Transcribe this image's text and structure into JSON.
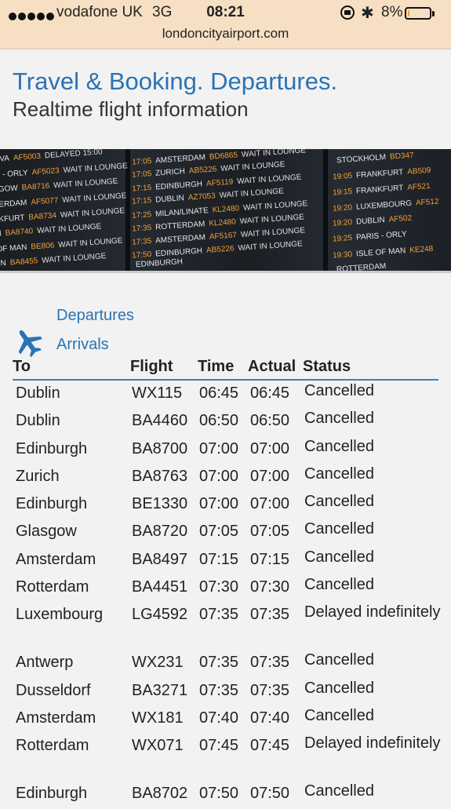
{
  "status_bar": {
    "carrier": "vodafone UK",
    "network": "3G",
    "time": "08:21",
    "battery": "8%",
    "battery_level": 0.08,
    "url": "londoncityairport.com"
  },
  "header": {
    "title": "Travel & Booking. Departures.",
    "subtitle": "Realtime flight information"
  },
  "banner": {
    "board1": [
      [
        "",
        "STOCKHOLM",
        "BD347",
        ""
      ],
      [
        "19:05",
        "FRANKFURT",
        "AB509",
        ""
      ],
      [
        "19:15",
        "FRANKFURT",
        "AF521",
        ""
      ],
      [
        "19:20",
        "LUXEMBOURG",
        "AF512",
        ""
      ],
      [
        "19:20",
        "DUBLIN",
        "AF502",
        ""
      ],
      [
        "19:25",
        "PARIS - ORLY",
        "",
        ""
      ],
      [
        "19:30",
        "ISLE OF MAN",
        "KE248",
        ""
      ],
      [
        "",
        "ROTTERDAM",
        "",
        ""
      ]
    ],
    "board2": [
      [
        "17:05",
        "AMSTERDAM",
        "BD6865",
        "WAIT IN LOUNGE"
      ],
      [
        "17:05",
        "ZURICH",
        "AB5226",
        "WAIT IN LOUNGE"
      ],
      [
        "17:15",
        "EDINBURGH",
        "AF5119",
        "WAIT IN LOUNGE"
      ],
      [
        "17:15",
        "DUBLIN",
        "AZ7053",
        "WAIT IN LOUNGE"
      ],
      [
        "17:25",
        "MILAN/LINATE",
        "KL2480",
        "WAIT IN LOUNGE"
      ],
      [
        "17:35",
        "ROTTERDAM",
        "KL2480",
        "WAIT IN LOUNGE"
      ],
      [
        "17:35",
        "AMSTERDAM",
        "AF5167",
        "WAIT IN LOUNGE"
      ],
      [
        "17:50",
        "EDINBURGH",
        "AB5226",
        "WAIT IN LOUNGE"
      ],
      [
        "",
        "EDINBURGH",
        "",
        ""
      ]
    ],
    "board3": [
      [
        "",
        "GENEVA",
        "AF5003",
        "DELAYED 15:00"
      ],
      [
        "",
        "PARIS - ORLY",
        "AF5023",
        "WAIT IN LOUNGE"
      ],
      [
        "",
        "GLASGOW",
        "BA8716",
        "WAIT IN LOUNGE"
      ],
      [
        "",
        "ROTTERDAM",
        "AF5077",
        "WAIT IN LOUNGE"
      ],
      [
        "",
        "FRANKFURT",
        "BA8734",
        "WAIT IN LOUNGE"
      ],
      [
        "",
        "MILAN",
        "BA8740",
        "WAIT IN LOUNGE"
      ],
      [
        "",
        "ISLE OF MAN",
        "BE806",
        "WAIT IN LOUNGE"
      ],
      [
        "",
        "DUBLIN",
        "BA8455",
        "WAIT IN LOUNGE"
      ]
    ]
  },
  "nav": {
    "departures": "Departures",
    "arrivals": "Arrivals"
  },
  "table": {
    "columns": [
      "To",
      "Flight",
      "Time",
      "Actual",
      "Status"
    ],
    "rows": [
      {
        "to": "Dublin",
        "flight": "WX115",
        "time": "06:45",
        "actual": "06:45",
        "status": "Cancelled"
      },
      {
        "to": "Dublin",
        "flight": "BA4460",
        "time": "06:50",
        "actual": "06:50",
        "status": "Cancelled"
      },
      {
        "to": "Edinburgh",
        "flight": "BA8700",
        "time": "07:00",
        "actual": "07:00",
        "status": "Cancelled"
      },
      {
        "to": "Zurich",
        "flight": "BA8763",
        "time": "07:00",
        "actual": "07:00",
        "status": "Cancelled"
      },
      {
        "to": "Edinburgh",
        "flight": "BE1330",
        "time": "07:00",
        "actual": "07:00",
        "status": "Cancelled"
      },
      {
        "to": "Glasgow",
        "flight": "BA8720",
        "time": "07:05",
        "actual": "07:05",
        "status": "Cancelled"
      },
      {
        "to": "Amsterdam",
        "flight": "BA8497",
        "time": "07:15",
        "actual": "07:15",
        "status": "Cancelled"
      },
      {
        "to": "Rotterdam",
        "flight": "BA4451",
        "time": "07:30",
        "actual": "07:30",
        "status": "Cancelled"
      },
      {
        "to": "Luxembourg",
        "flight": "LG4592",
        "time": "07:35",
        "actual": "07:35",
        "status": "Delayed indefinitely"
      },
      {
        "to": "Antwerp",
        "flight": "WX231",
        "time": "07:35",
        "actual": "07:35",
        "status": "Cancelled"
      },
      {
        "to": "Dusseldorf",
        "flight": "BA3271",
        "time": "07:35",
        "actual": "07:35",
        "status": "Cancelled"
      },
      {
        "to": "Amsterdam",
        "flight": "WX181",
        "time": "07:40",
        "actual": "07:40",
        "status": "Cancelled"
      },
      {
        "to": "Rotterdam",
        "flight": "WX071",
        "time": "07:45",
        "actual": "07:45",
        "status": "Delayed indefinitely"
      },
      {
        "to": "Edinburgh",
        "flight": "BA8702",
        "time": "07:50",
        "actual": "07:50",
        "status": "Cancelled"
      }
    ]
  }
}
